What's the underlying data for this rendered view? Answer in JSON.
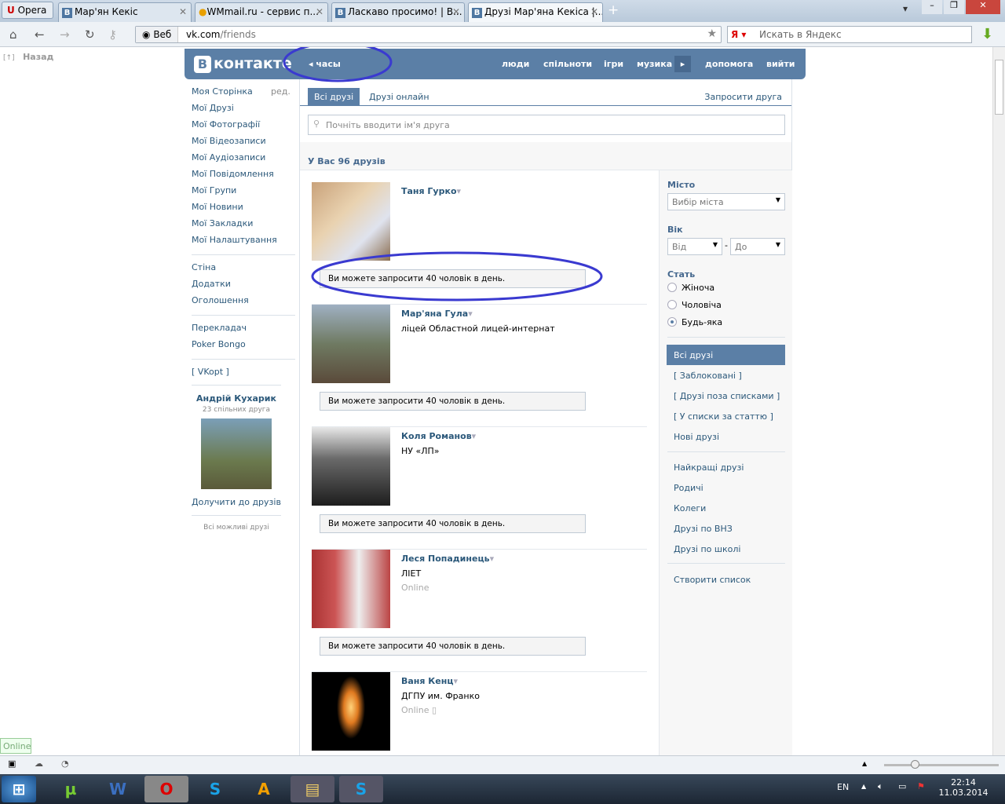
{
  "browser": {
    "opera_label": "Opera",
    "tabs": [
      "Мар'ян Кекіс",
      "WMmail.ru - сервис п...",
      "Ласкаво просимо! | В...",
      "Друзі Мар'яна Кекіса |..."
    ],
    "web_label": "Веб",
    "url_domain": "vk.com",
    "url_path": "/friends",
    "search_placeholder": "Искать в Яндекс",
    "back_label": "Назад"
  },
  "header": {
    "logo": "контакте",
    "logo_letter": "В",
    "clock": "часы",
    "nav": [
      "люди",
      "спільноти",
      "ігри",
      "музика",
      "допомога",
      "вийти"
    ]
  },
  "left_menu": {
    "edit": "ред.",
    "groups": [
      [
        "Моя Сторінка",
        "Мої Друзі",
        "Мої Фотографії",
        "Мої Відеозаписи",
        "Мої Аудіозаписи",
        "Мої Повідомлення",
        "Мої Групи",
        "Мої Новини",
        "Мої Закладки",
        "Мої Налаштування"
      ],
      [
        "Стіна",
        "Додатки",
        "Оголошення"
      ],
      [
        "Перекладач",
        "Poker Bongo"
      ],
      [
        "[ VKopt ]"
      ]
    ],
    "suggest": {
      "name": "Андрій Кухарик",
      "mutual": "23 спільних друга",
      "add": "Долучити до друзів",
      "all": "Всі можливі друзі"
    }
  },
  "tabs": {
    "all": "Всі друзі",
    "online": "Друзі онлайн",
    "invite": "Запросити друга"
  },
  "search": {
    "placeholder": "Почніть вводити ім'я друга"
  },
  "count": "У Вас 96 друзів",
  "friends": [
    {
      "name": "Таня Гурко",
      "info": "",
      "status": "",
      "invite": "Ви можете запросити 40 чоловік в день."
    },
    {
      "name": "Мар'яна Гула",
      "info": "ліцей Областной лицей-интернат",
      "status": "",
      "invite": "Ви можете запросити 40 чоловік в день."
    },
    {
      "name": "Коля Романов",
      "info": "НУ «ЛП»",
      "status": "",
      "invite": "Ви можете запросити 40 чоловік в день."
    },
    {
      "name": "Леся Попадинець",
      "info": "ЛІЕТ",
      "status": "Online",
      "invite": "Ви можете запросити 40 чоловік в день."
    },
    {
      "name": "Ваня Кенц",
      "info": "ДГПУ им. Франко",
      "status": "Online",
      "invite": ""
    }
  ],
  "filters": {
    "city_label": "Місто",
    "city": "Вибір міста",
    "age_label": "Вік",
    "from": "Від",
    "to": "До",
    "sex_label": "Стать",
    "sex": [
      "Жіноча",
      "Чоловіча",
      "Будь-яка"
    ],
    "lists1": [
      "Всі друзі",
      "[ Заблоковані ]",
      "[ Друзі поза списками ]",
      "[ У списки за статтю ]",
      "Нові друзі"
    ],
    "lists2": [
      "Найкращі друзі",
      "Родичі",
      "Колеги",
      "Друзі по ВНЗ",
      "Друзі по школі"
    ],
    "create": "Створити список"
  },
  "statusbar": {
    "online": "Online"
  },
  "taskbar": {
    "lang": "EN",
    "time": "22:14",
    "date": "11.03.2014"
  }
}
